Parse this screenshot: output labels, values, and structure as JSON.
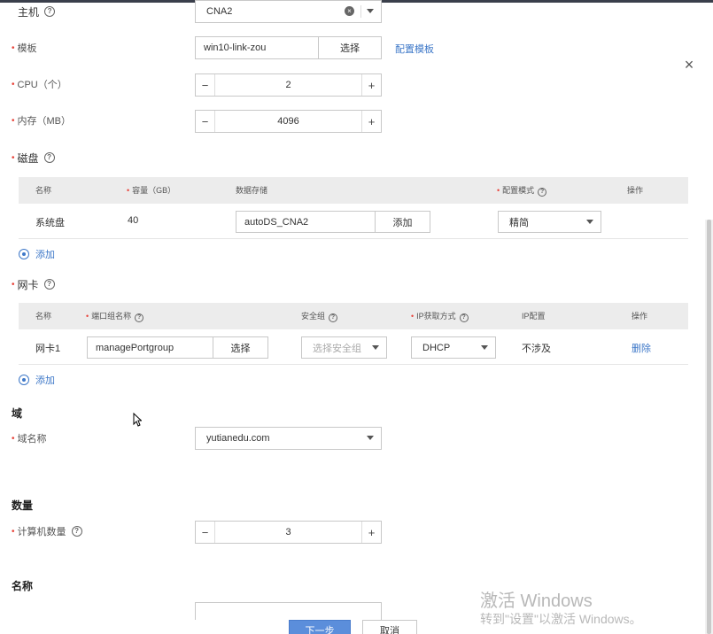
{
  "form": {
    "host": {
      "label": "主机",
      "value": "CNA2"
    },
    "template": {
      "label": "模板",
      "value": "win10-link-zou",
      "select_label": "选择",
      "config_link": "配置模板"
    },
    "cpu": {
      "label": "CPU（个）",
      "value": "2",
      "minus": "−",
      "plus": "+"
    },
    "memory": {
      "label": "内存（MB）",
      "value": "4096",
      "minus": "−",
      "plus": "+"
    },
    "disk": {
      "label": "磁盘",
      "headers": {
        "name": "名称",
        "capacity": "容量（GB）",
        "storage": "数据存储",
        "mode": "配置模式",
        "ops": "操作"
      },
      "rows": [
        {
          "name": "系统盘",
          "capacity": "40",
          "storage": "autoDS_CNA2",
          "add_label": "添加",
          "mode": "精简"
        }
      ],
      "add_label": "添加"
    },
    "nic": {
      "label": "网卡",
      "headers": {
        "name": "名称",
        "portgroup": "端口组名称",
        "security": "安全组",
        "ip_mode": "IP获取方式",
        "ip_config": "IP配置",
        "ops": "操作"
      },
      "rows": [
        {
          "name": "网卡1",
          "portgroup": "managePortgroup",
          "select_label": "选择",
          "security_placeholder": "选择安全组",
          "ip_mode": "DHCP",
          "ip_config": "不涉及",
          "delete_label": "删除"
        }
      ],
      "add_label": "添加"
    },
    "domain_section": {
      "title": "域",
      "name_label": "域名称",
      "name_value": "yutianedu.com"
    },
    "quantity_section": {
      "title": "数量",
      "count_label": "计算机数量",
      "count_value": "3",
      "minus": "−",
      "plus": "+"
    },
    "name_section": {
      "title": "名称"
    }
  },
  "close": "×",
  "footer": {
    "next": "下一步",
    "cancel": "取消"
  },
  "watermark": {
    "line1": "激活 Windows",
    "line2": "转到\"设置\"以激活 Windows。"
  },
  "colors": {
    "link": "#3e78c8",
    "primary": "#5b8edb",
    "required": "#e8453c",
    "table_header": "#ececec"
  },
  "icons": {
    "help": "help-circle-icon",
    "clear": "clear-circle-icon",
    "close": "close-icon",
    "add": "add-circle-icon",
    "cursor": "mouse-pointer-icon"
  }
}
